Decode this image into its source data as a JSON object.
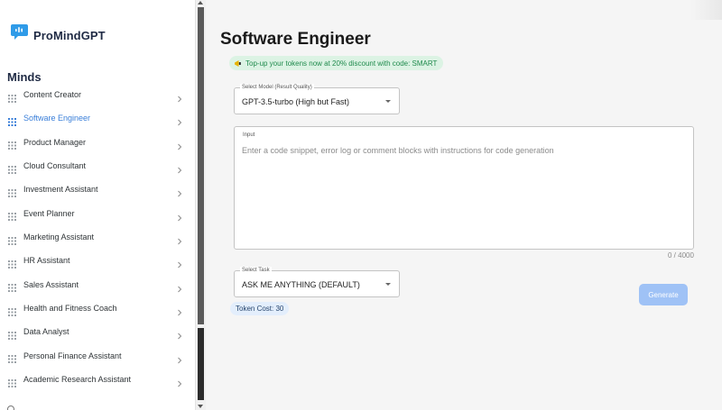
{
  "brand": {
    "name": "ProMindGPT",
    "accent": "#2f9be8"
  },
  "sidebar": {
    "heading": "Minds",
    "items": [
      {
        "label": "Content Creator",
        "active": false
      },
      {
        "label": "Software Engineer",
        "active": true
      },
      {
        "label": "Product Manager",
        "active": false
      },
      {
        "label": "Cloud Consultant",
        "active": false
      },
      {
        "label": "Investment Assistant",
        "active": false
      },
      {
        "label": "Event Planner",
        "active": false
      },
      {
        "label": "Marketing Assistant",
        "active": false
      },
      {
        "label": "HR Assistant",
        "active": false
      },
      {
        "label": "Sales Assistant",
        "active": false
      },
      {
        "label": "Health and Fitness Coach",
        "active": false
      },
      {
        "label": "Data Analyst",
        "active": false
      },
      {
        "label": "Personal Finance Assistant",
        "active": false
      },
      {
        "label": "Academic Research Assistant",
        "active": false
      }
    ],
    "item_icon": "grid-icon",
    "chevron_icon": "chevron-right-icon"
  },
  "main": {
    "title": "Software Engineer",
    "promo": {
      "icon": "megaphone-icon",
      "text": "Top-up your tokens now at 20% discount with code: SMART"
    },
    "model_select": {
      "label": "Select Model (Result Quality)",
      "value": "GPT-3.5-turbo (High but Fast)"
    },
    "input": {
      "label": "Input",
      "placeholder": "Enter a code snippet, error log or comment blocks with instructions for code generation",
      "counter": "0 / 4000"
    },
    "task_select": {
      "label": "Select Task",
      "value": "ASK ME ANYTHING (DEFAULT)"
    },
    "token_cost": "Token Cost: 30",
    "generate_label": "Generate"
  },
  "colors": {
    "active_nav": "#3a7fd9",
    "promo_bg": "#dcf3e4",
    "promo_text": "#1f8a4c",
    "generate_bg": "#9fc2f6",
    "token_badge_bg": "#e3eefc"
  }
}
